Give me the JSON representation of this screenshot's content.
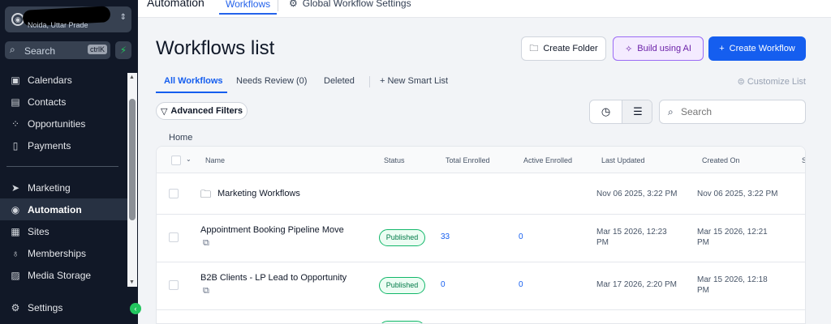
{
  "sidebar": {
    "location_sub": "Noida, Uttar Prade",
    "search_placeholder": "Search",
    "search_shortcut": "ctrlK",
    "items": [
      {
        "label": "Calendars",
        "icon": "calendar-icon"
      },
      {
        "label": "Contacts",
        "icon": "contacts-icon"
      },
      {
        "label": "Opportunities",
        "icon": "opportunities-icon"
      },
      {
        "label": "Payments",
        "icon": "payments-icon"
      },
      {
        "label": "Marketing",
        "icon": "send-icon"
      },
      {
        "label": "Automation",
        "icon": "automation-icon"
      },
      {
        "label": "Sites",
        "icon": "sites-icon"
      },
      {
        "label": "Memberships",
        "icon": "memberships-icon"
      },
      {
        "label": "Media Storage",
        "icon": "image-icon"
      },
      {
        "label": "Settings",
        "icon": "gear-icon"
      }
    ],
    "active_item": "Automation"
  },
  "topbar": {
    "section": "Automation",
    "tab_workflows": "Workflows",
    "tab_global": "Global Workflow Settings"
  },
  "page": {
    "title": "Workflows list",
    "create_folder": "Create Folder",
    "build_ai": "Build using AI",
    "create_workflow": "Create Workflow",
    "tabs": [
      "All Workflows",
      "Needs Review (0)",
      "Deleted"
    ],
    "new_smart_list": "New Smart List",
    "customize_list": "Customize List",
    "advanced_filters": "Advanced Filters",
    "search_placeholder": "Search",
    "breadcrumb": "Home"
  },
  "table": {
    "columns": [
      "Name",
      "Status",
      "Total Enrolled",
      "Active Enrolled",
      "Last Updated",
      "Created On",
      "S"
    ],
    "rows": [
      {
        "name": "Marketing Workflows",
        "type": "folder",
        "status": "",
        "total": "",
        "active": "",
        "updated": "Nov 06 2025, 3:22 PM",
        "created": "Nov 06 2025, 3:22 PM"
      },
      {
        "name": "Appointment Booking Pipeline Move",
        "type": "workflow",
        "status": "Published",
        "total": "33",
        "active": "0",
        "updated_l1": "Mar 15 2026, 12:23",
        "updated_l2": "PM",
        "created_l1": "Mar 15 2026, 12:21",
        "created_l2": "PM"
      },
      {
        "name": "B2B Clients - LP Lead to Opportunity",
        "type": "workflow",
        "status": "Published",
        "total": "0",
        "active": "0",
        "updated_l1": "Mar 17 2026, 2:20 PM",
        "updated_l2": "",
        "created_l1": "Mar 15 2026, 12:18",
        "created_l2": "PM"
      }
    ]
  },
  "colors": {
    "sidebar_bg": "#111827",
    "accent": "#155eef",
    "ai_purple": "#9b6bf5",
    "published_green": "#12b76a"
  }
}
